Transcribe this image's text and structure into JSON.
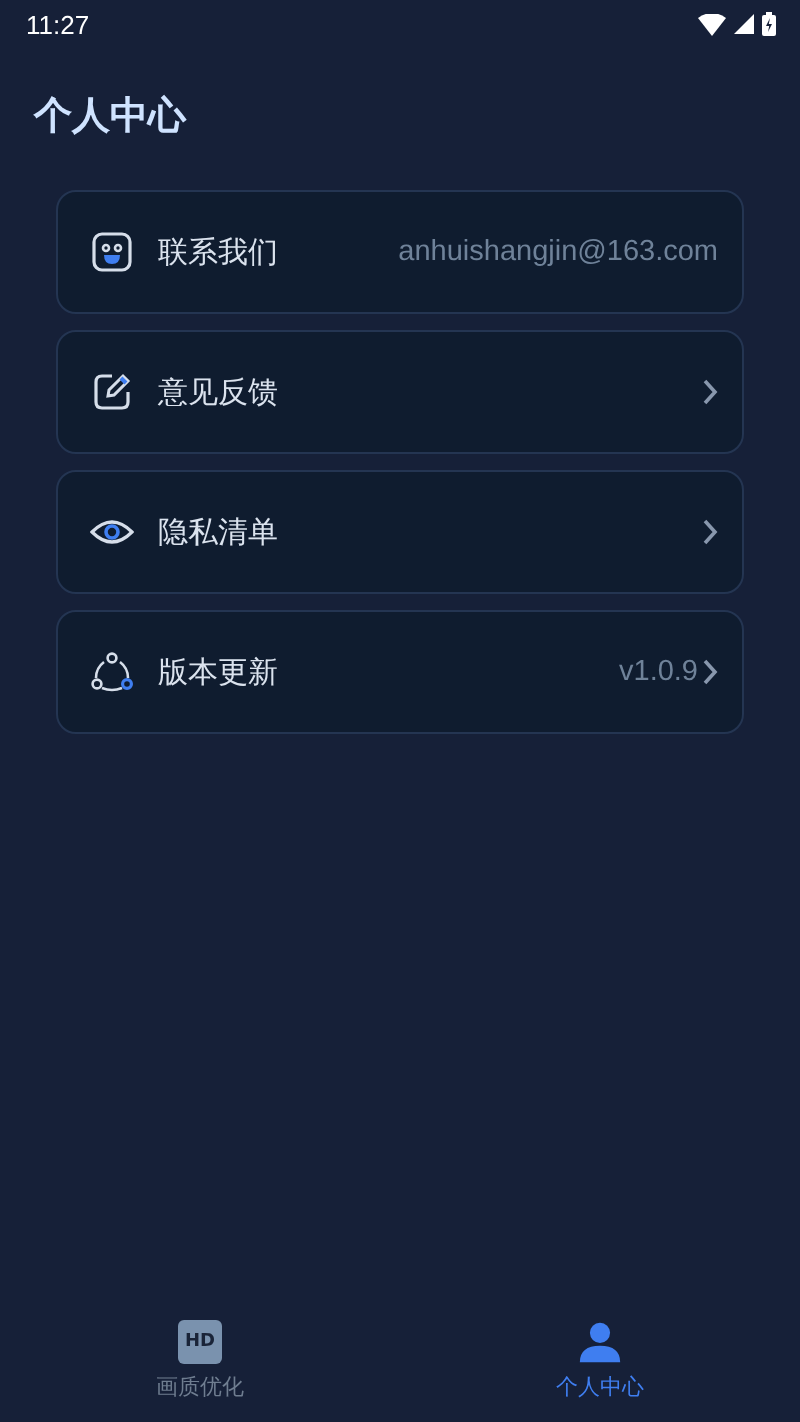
{
  "status_bar": {
    "time": "11:27"
  },
  "title": "个人中心",
  "items": [
    {
      "label": "联系我们",
      "value": "anhuishangjin@163.com",
      "chevron": false
    },
    {
      "label": "意见反馈",
      "chevron": true
    },
    {
      "label": "隐私清单",
      "chevron": true
    },
    {
      "label": "版本更新",
      "value": "v1.0.9",
      "chevron": true
    }
  ],
  "tabs": [
    {
      "label": "画质优化",
      "badge": "HD",
      "selected": false
    },
    {
      "label": "个人中心",
      "selected": true
    }
  ]
}
